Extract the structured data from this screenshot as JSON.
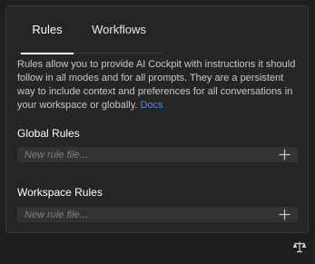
{
  "tabs": [
    {
      "label": "Rules",
      "active": true
    },
    {
      "label": "Workflows",
      "active": false
    }
  ],
  "description": {
    "text": "Rules allow you to provide AI Cockpit with instructions it should follow in all modes and for all prompts. They are a persistent way to include context and preferences for all conversations in your workspace or globally.",
    "link_label": "Docs"
  },
  "global_rules": {
    "title": "Global Rules",
    "placeholder": "New rule file..."
  },
  "workspace_rules": {
    "title": "Workspace Rules",
    "placeholder": "New rule file..."
  },
  "icons": {
    "add": "plus-icon",
    "footer": "scale-icon"
  },
  "colors": {
    "panel_bg": "#252526",
    "input_bg": "#333333",
    "link": "#3794ff",
    "active_tab_underline": "#ffffff"
  }
}
